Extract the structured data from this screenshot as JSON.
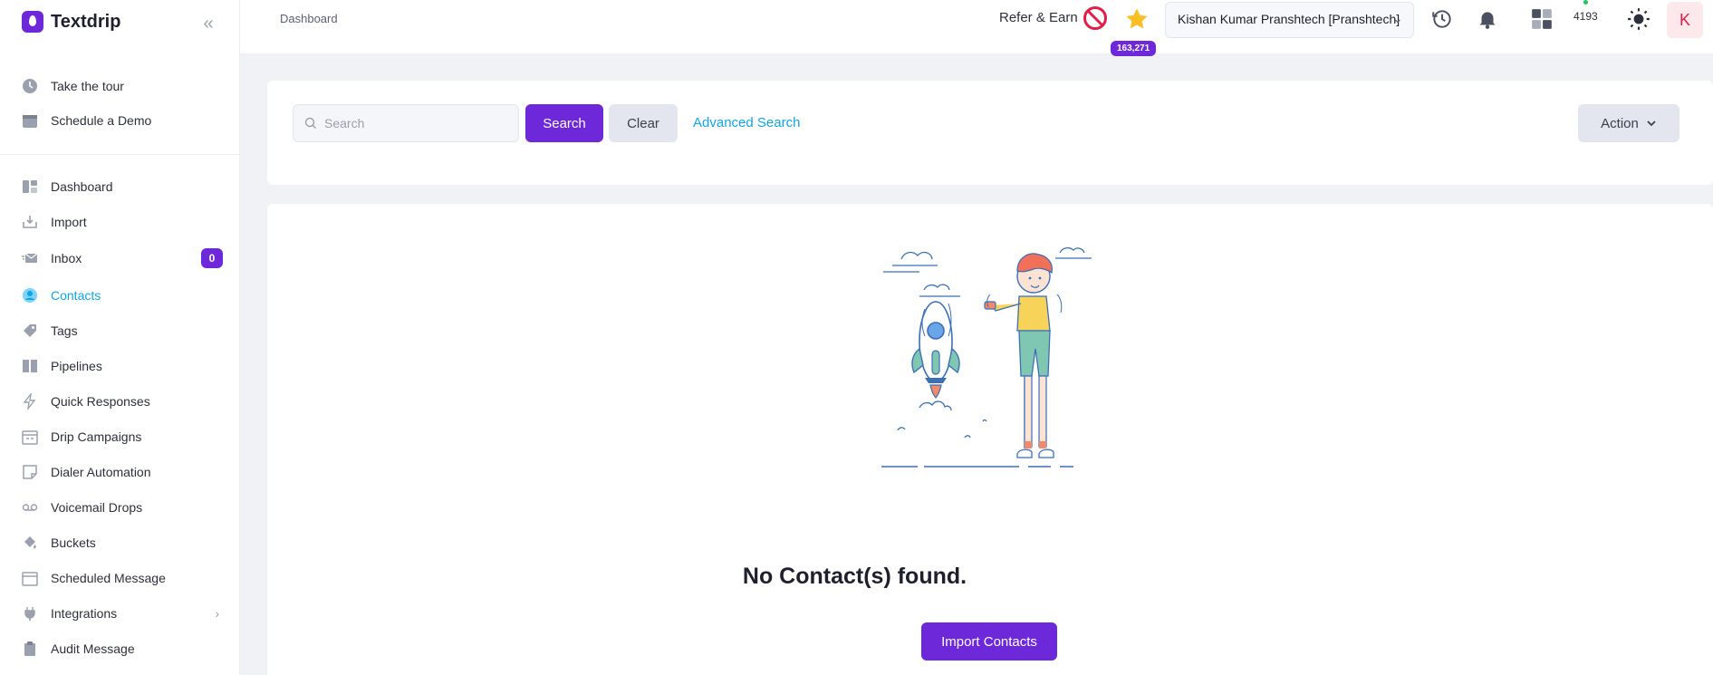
{
  "brand": {
    "name": "Textdrip"
  },
  "sidebar": {
    "top_items": [
      {
        "label": "Take the tour"
      },
      {
        "label": "Schedule a Demo"
      }
    ],
    "items": [
      {
        "label": "Dashboard"
      },
      {
        "label": "Import"
      },
      {
        "label": "Inbox",
        "badge": "0"
      },
      {
        "label": "Contacts",
        "active": true
      },
      {
        "label": "Tags"
      },
      {
        "label": "Pipelines"
      },
      {
        "label": "Quick Responses"
      },
      {
        "label": "Drip Campaigns"
      },
      {
        "label": "Dialer Automation"
      },
      {
        "label": "Voicemail Drops"
      },
      {
        "label": "Buckets"
      },
      {
        "label": "Scheduled Message"
      },
      {
        "label": "Integrations",
        "has_submenu": true
      },
      {
        "label": "Audit Message"
      }
    ]
  },
  "header": {
    "breadcrumb": "Dashboard",
    "refer_label": "Refer & Earn",
    "points_badge": "163,271",
    "account_name": "Kishan Kumar Pranshtech [Pranshtech]",
    "calls_count": "4193",
    "avatar_initial": "K"
  },
  "search": {
    "placeholder": "Search",
    "search_button": "Search",
    "clear_button": "Clear",
    "advanced_link": "Advanced Search",
    "action_button": "Action"
  },
  "empty_state": {
    "title": "No Contact(s) found.",
    "import_button": "Import Contacts"
  },
  "colors": {
    "accent": "#6d28d9",
    "link": "#0ea5e9",
    "page_bg": "#f1f2f6"
  }
}
